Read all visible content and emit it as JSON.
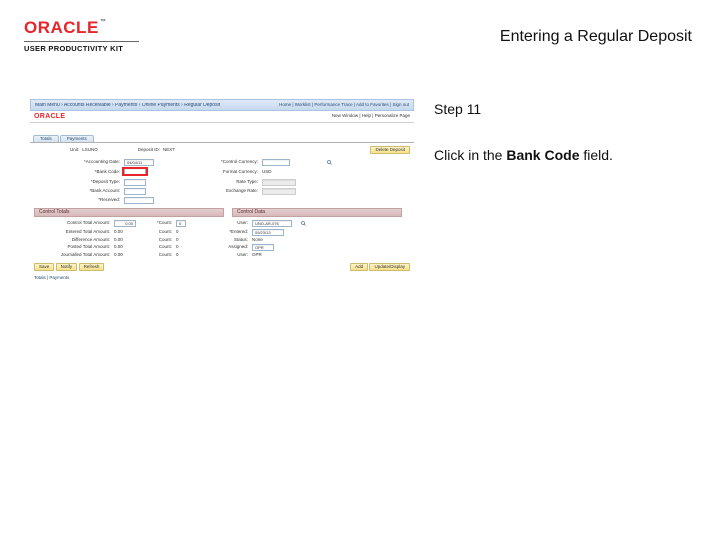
{
  "header": {
    "logo_text": "ORACLE",
    "logo_tm": "™",
    "logo_subtitle": "USER PRODUCTIVITY KIT",
    "page_title": "Entering a Regular Deposit"
  },
  "instructions": {
    "step_label": "Step 11",
    "desc_prefix": "Click in the ",
    "desc_bold": "Bank Code",
    "desc_suffix": " field."
  },
  "screenshot": {
    "breadcrumbs": "Main Menu › Accounts Receivable › Payments › Online Payments › Regular Deposit",
    "top_links": "Home | Worklist | Performance Trace | Add to Favorites | Sign out",
    "brand": "ORACLE",
    "brand_right": "New Window | Help | Personalize Page",
    "tabs": [
      "Totals",
      "Payments"
    ],
    "row1": {
      "unit_label": "Unit:",
      "unit_value": "LSUNO",
      "deposit_label": "Deposit ID:",
      "deposit_value": "NEXT",
      "delete_btn": "Delete Deposit"
    },
    "grid2": {
      "acct_date_lbl": "*Accounting Date:",
      "acct_date_val": "04/04/11",
      "control_cur_lbl": "*Control Currency:",
      "bank_code_lbl": "*Bank Code:",
      "format_cur_lbl": "Format Currency:",
      "format_cur_val": "USD",
      "deposit_type_lbl": "*Deposit Type:",
      "rate_type_lbl": "Rate Type:",
      "bank_acct_lbl": "*Bank Account:",
      "exch_rate_lbl": "Exchange Rate:",
      "received_lbl": "*Received:"
    },
    "sections": {
      "control_totals": "Control Totals",
      "control_data": "Control Data"
    },
    "totals": {
      "ctrl_total_amt_lbl": "Control Total Amount:",
      "ctrl_total_amt_val": "0.00",
      "count1_lbl": "*Count:",
      "count1_val": "0",
      "user_lbl": "User:",
      "user_val": "UNO-AR-076",
      "entered_amt_lbl": "Entered Total Amount:",
      "entered_amt_val": "0.00",
      "count2_lbl": "Count:",
      "count2_val": "0",
      "entered_lbl": "*Entered:",
      "entered_val": "09/23/13",
      "diff_amt_lbl": "Difference Amount:",
      "diff_amt_val": "0.00",
      "count3_lbl": "Count:",
      "count3_val": "0",
      "status_lbl": "Status:",
      "status_val": "None",
      "posted_amt_lbl": "Posted Total Amount:",
      "posted_amt_val": "0.00",
      "count4_lbl": "Count:",
      "count4_val": "0",
      "assigned_lbl": "Assigned:",
      "assigned_val": "OPR",
      "journal_amt_lbl": "Journalled Total Amount:",
      "journal_amt_val": "0.00",
      "count5_lbl": "Count:",
      "count5_val": "0",
      "user2_lbl": "User:",
      "user2_val": "OPR"
    },
    "footer": {
      "save": "Save",
      "notify": "Notify",
      "refresh": "Refresh",
      "add": "Add",
      "update": "Update/Display"
    },
    "timestamp_link": "Totals | Payments"
  }
}
